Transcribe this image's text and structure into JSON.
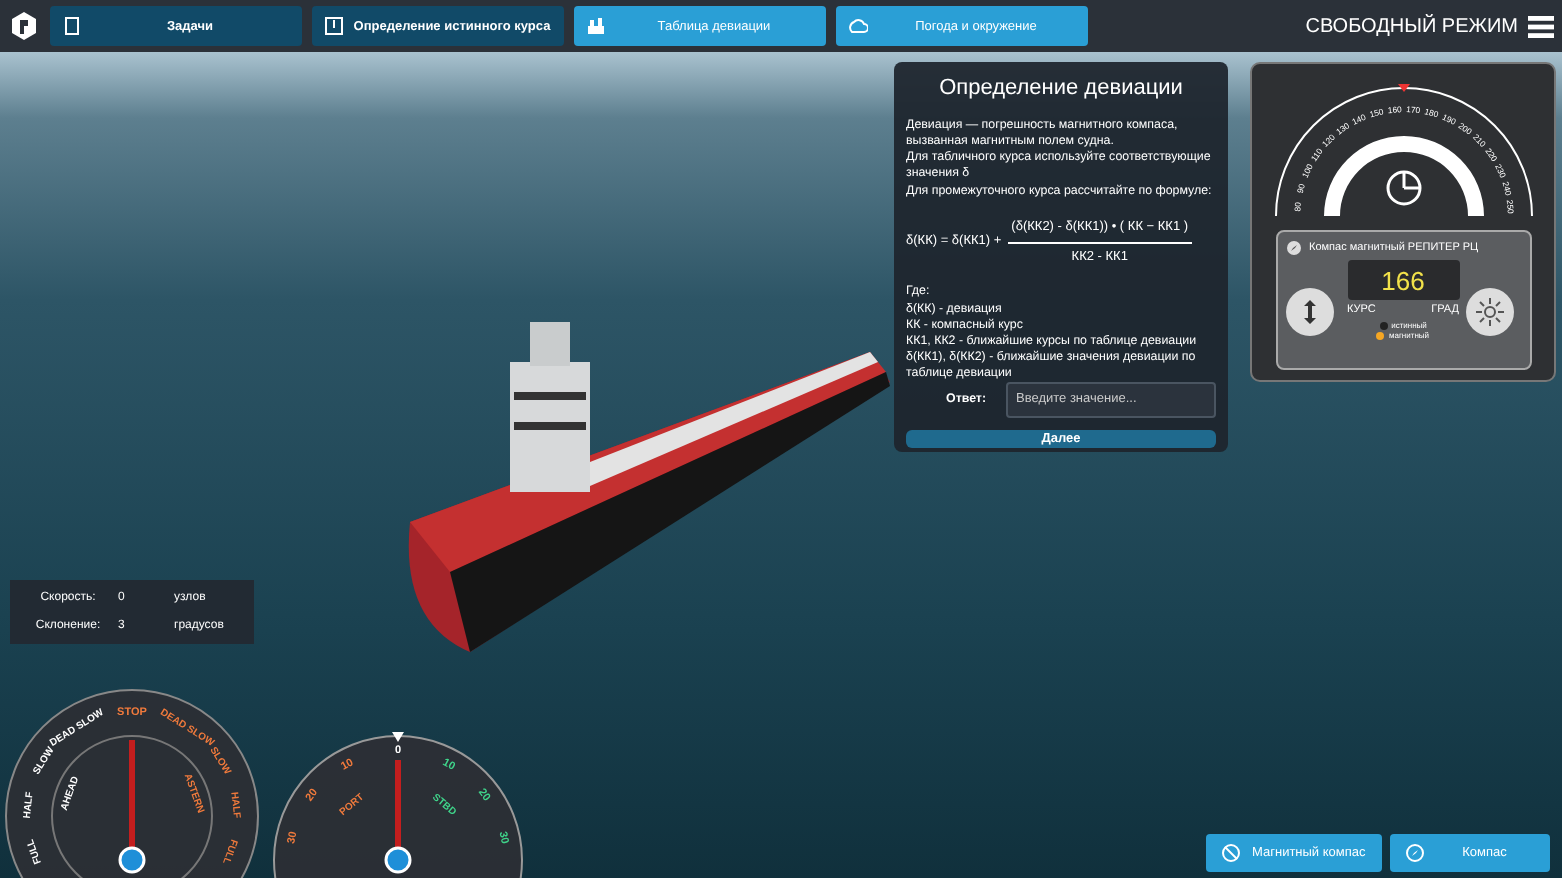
{
  "top_bar": {
    "tabs": [
      {
        "label": "Задачи",
        "selected": false
      },
      {
        "label": "Определение истинного курса",
        "selected": false
      },
      {
        "label": "Таблица девиации",
        "selected": true
      },
      {
        "label": "Погода и окружение",
        "selected": true
      }
    ],
    "mode": "СВОБОДНЫЙ РЕЖИМ"
  },
  "deviation_panel": {
    "title": "Определение девиации",
    "intro": [
      "Девиация — погрешность магнитного компаса, вызванная магнитным полем судна.",
      "Для табличного курса используйте соответствующие значения δ",
      "Для промежуточного курса рассчитайте по формуле:"
    ],
    "formula": {
      "left": "δ(КК) = δ(КК1) +",
      "numerator": "(δ(КК2) - δ(КК1)) • ( КК − КК1 )",
      "denominator": "КК2 - КК1"
    },
    "legend": [
      "Где:",
      "δ(КК) - девиация",
      "КК - компасный курс",
      "КК1, КК2 - ближайшие курсы по таблице девиации",
      "δ(КК1), δ(КК2) - ближайшие значения девиации по таблице девиации"
    ],
    "answer_label": "Ответ:",
    "answer_placeholder": "Введите значение...",
    "next_button": "Далее"
  },
  "compass": {
    "scale": [
      "80",
      "90",
      "100",
      "110",
      "120",
      "130",
      "140",
      "150",
      "160",
      "170",
      "180",
      "190",
      "200",
      "210",
      "220",
      "230",
      "240",
      "250"
    ],
    "device": "Компас магнитный РЕПИТЕР РЦ",
    "reading": "166",
    "course_label": "КУРС",
    "unit_label": "ГРАД",
    "indicators": [
      {
        "label": "истинный",
        "on": false
      },
      {
        "label": "магнитный",
        "on": true
      }
    ]
  },
  "info": [
    {
      "label": "Скорость:",
      "value": "0",
      "unit": "узлов"
    },
    {
      "label": "Склонение:",
      "value": "3",
      "unit": "градусов"
    }
  ],
  "telegraph": {
    "stop": "STOP",
    "ahead": {
      "label": "AHEAD",
      "steps": [
        "DEAD SLOW",
        "SLOW",
        "HALF",
        "FULL"
      ]
    },
    "astern": {
      "label": "ASTERN",
      "steps": [
        "DEAD SLOW",
        "SLOW",
        "HALF",
        "FULL"
      ]
    }
  },
  "rudder": {
    "zero": "0",
    "starboard": {
      "label": "STBD",
      "ticks": [
        "10",
        "20",
        "30"
      ]
    },
    "port": {
      "label": "PORT",
      "ticks": [
        "10",
        "20",
        "30"
      ]
    }
  },
  "bottom_buttons": [
    "Магнитный компас",
    "Компас"
  ]
}
